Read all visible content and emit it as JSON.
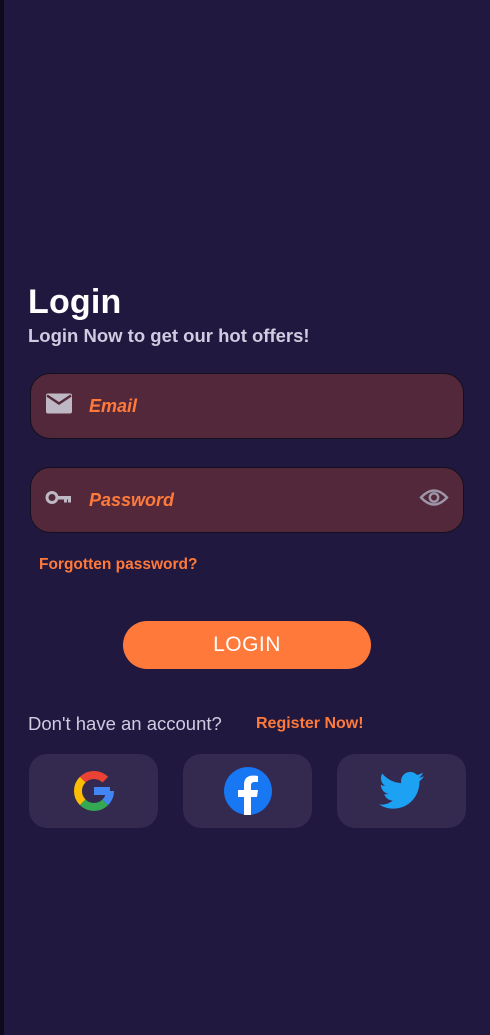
{
  "header": {
    "title": "Login",
    "subtitle": "Login Now to get our hot offers!"
  },
  "form": {
    "email": {
      "placeholder": "Email",
      "value": "",
      "icon": "mail-icon"
    },
    "password": {
      "placeholder": "Password",
      "value": "",
      "icon": "key-icon",
      "toggle_icon": "eye-icon"
    },
    "forgot_label": "Forgotten password?",
    "login_label": "LOGIN"
  },
  "register": {
    "prompt": "Don't have an account?",
    "link_label": "Register Now!"
  },
  "social": [
    {
      "name": "Google",
      "icon": "google-icon"
    },
    {
      "name": "Facebook",
      "icon": "facebook-icon"
    },
    {
      "name": "Twitter",
      "icon": "twitter-icon"
    }
  ],
  "colors": {
    "background": "#21183f",
    "accent": "#ff7a3a",
    "field_background": "#53283a",
    "social_background": "#34294f"
  }
}
